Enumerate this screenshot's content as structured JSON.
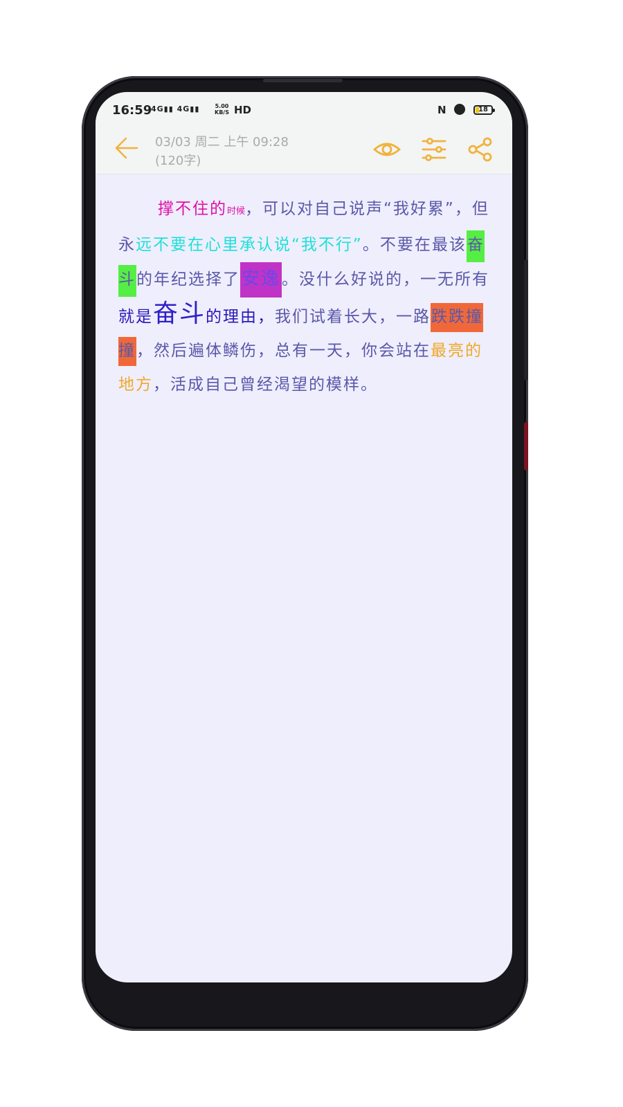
{
  "status_bar": {
    "time": "16:59",
    "network": "4G▮▮ 4G▮▮",
    "speed_value": "5.00",
    "speed_unit": "KB/S",
    "hd": "HD",
    "nfc": "N",
    "battery": "18",
    "battery_color": "#f5c400"
  },
  "header": {
    "date": "03/03 周二 上午 09:28",
    "word_count": "(120字)",
    "back_icon": "arrow-left-icon",
    "actions": [
      "eye-icon",
      "sliders-icon",
      "share-icon"
    ],
    "accent_color": "#f0b33c"
  },
  "note": {
    "seg1": "撑不住的",
    "seg2": "时候",
    "seg3": "，可以对自己说声“我好累”，但永",
    "seg4": "远不要在心里承认说“我不行”",
    "seg5": "。不要在最该",
    "seg6": "奋斗",
    "seg7": "的年纪选择了",
    "seg8": "安逸",
    "seg9": "。没什么好说的，一无所有",
    "seg10": "就是",
    "seg11": "奋斗",
    "seg12": "的理由，",
    "seg13": "我们试着长大，一路",
    "seg14": "跌跌撞撞",
    "seg15": "，然后遍体鳞伤，总有一天，你会站在",
    "seg16": "最亮的地方",
    "seg17": "，活成自己曾经渴望的模样。"
  }
}
